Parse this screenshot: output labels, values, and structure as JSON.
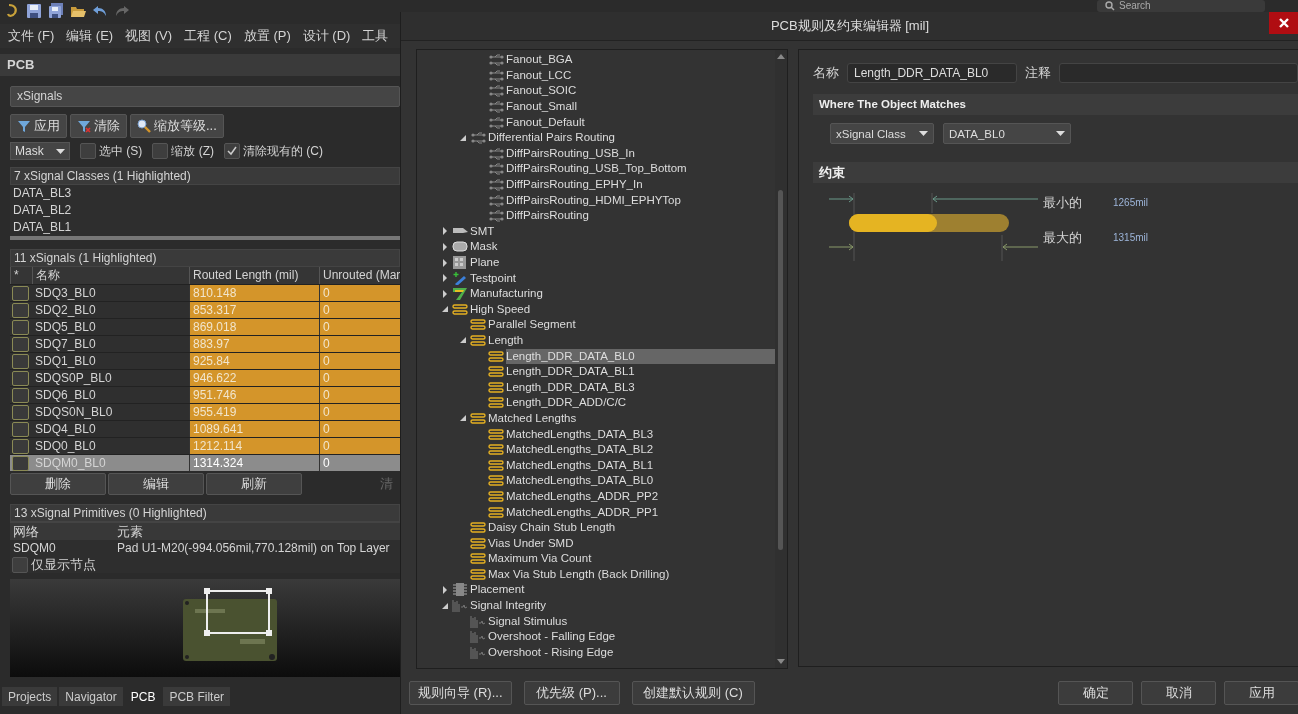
{
  "menu": [
    "文件 (F)",
    "编辑 (E)",
    "视图 (V)",
    "工程 (C)",
    "放置 (P)",
    "设计 (D)",
    "工具"
  ],
  "search": {
    "placeholder": "Search"
  },
  "panel": {
    "title": "PCB",
    "mode": "xSignals",
    "buttons": [
      {
        "kind": "filter",
        "label": "应用"
      },
      {
        "kind": "clear",
        "label": "清除"
      },
      {
        "kind": "zoom",
        "label": "缩放等级..."
      }
    ],
    "mask": "Mask",
    "options": [
      {
        "label": "选中 (S)",
        "checked": false
      },
      {
        "label": "缩放 (Z)",
        "checked": false
      },
      {
        "label": "清除现有的 (C)",
        "checked": true
      }
    ],
    "classes": {
      "header": "7 xSignal Classes (1 Highlighted)",
      "rows": [
        "DATA_BL3",
        "DATA_BL2",
        "DATA_BL1"
      ]
    },
    "signals": {
      "header": "11 xSignals (1 Highlighted)",
      "columns": [
        "*",
        "名称",
        "Routed Length (mil)",
        "Unrouted (Mar"
      ],
      "rows": [
        {
          "name": "SDQ3_BL0",
          "routed": "810.148",
          "unrouted": "0",
          "selected": false
        },
        {
          "name": "SDQ2_BL0",
          "routed": "853.317",
          "unrouted": "0",
          "selected": false
        },
        {
          "name": "SDQ5_BL0",
          "routed": "869.018",
          "unrouted": "0",
          "selected": false
        },
        {
          "name": "SDQ7_BL0",
          "routed": "883.97",
          "unrouted": "0",
          "selected": false
        },
        {
          "name": "SDQ1_BL0",
          "routed": "925.84",
          "unrouted": "0",
          "selected": false
        },
        {
          "name": "SDQS0P_BL0",
          "routed": "946.622",
          "unrouted": "0",
          "selected": false
        },
        {
          "name": "SDQ6_BL0",
          "routed": "951.746",
          "unrouted": "0",
          "selected": false
        },
        {
          "name": "SDQS0N_BL0",
          "routed": "955.419",
          "unrouted": "0",
          "selected": false
        },
        {
          "name": "SDQ4_BL0",
          "routed": "1089.641",
          "unrouted": "0",
          "selected": false
        },
        {
          "name": "SDQ0_BL0",
          "routed": "1212.114",
          "unrouted": "0",
          "selected": false
        },
        {
          "name": "SDQM0_BL0",
          "routed": "1314.324",
          "unrouted": "0",
          "selected": true
        }
      ],
      "buttons": [
        {
          "label": "删除",
          "disabled": false
        },
        {
          "label": "编辑",
          "disabled": false
        },
        {
          "label": "刷新",
          "disabled": false
        },
        {
          "label": "清",
          "disabled": true
        }
      ]
    },
    "primitives": {
      "header": "13 xSignal Primitives (0 Highlighted)",
      "columns": [
        "网络",
        "元素"
      ],
      "rows": [
        {
          "net": "SDQM0",
          "element": "Pad U1-M20(-994.056mil,770.128mil) on Top Layer"
        }
      ],
      "nodes_only": {
        "label": "仅显示节点",
        "checked": false
      }
    },
    "tabs": [
      {
        "label": "Projects",
        "selected": false
      },
      {
        "label": "Navigator",
        "selected": false
      },
      {
        "label": "PCB",
        "selected": true
      },
      {
        "label": "PCB Filter",
        "selected": false
      }
    ]
  },
  "dialog": {
    "title": "PCB规则及约束编辑器 [mil]",
    "tree": [
      {
        "children": [
          {
            "children": [
              {
                "kind": "routing",
                "label": "Fanout_BGA",
                "selected": false
              },
              {
                "kind": "routing",
                "label": "Fanout_LCC",
                "selected": false
              },
              {
                "kind": "routing",
                "label": "Fanout_SOIC",
                "selected": false
              },
              {
                "kind": "routing",
                "label": "Fanout_Small",
                "selected": false
              },
              {
                "kind": "routing",
                "label": "Fanout_Default",
                "selected": false
              }
            ]
          },
          {
            "kind": "routing",
            "label": "Differential Pairs Routing",
            "expanded": true,
            "selected": false,
            "children": [
              {
                "kind": "routing",
                "label": "DiffPairsRouting_USB_In",
                "selected": false
              },
              {
                "kind": "routing",
                "label": "DiffPairsRouting_USB_Top_Bottom",
                "selected": false
              },
              {
                "kind": "routing",
                "label": "DiffPairsRouting_EPHY_In",
                "selected": false
              },
              {
                "kind": "routing",
                "label": "DiffPairsRouting_HDMI_EPHYTop",
                "selected": false
              },
              {
                "kind": "routing",
                "label": "DiffPairsRouting",
                "selected": false
              }
            ]
          }
        ]
      },
      {
        "kind": "smt",
        "label": "SMT",
        "expanded": false,
        "selected": false
      },
      {
        "kind": "mask",
        "label": "Mask",
        "expanded": false,
        "selected": false
      },
      {
        "kind": "plane",
        "label": "Plane",
        "expanded": false,
        "selected": false
      },
      {
        "kind": "testpoint",
        "label": "Testpoint",
        "expanded": false,
        "selected": false
      },
      {
        "kind": "manufacturing",
        "label": "Manufacturing",
        "expanded": false,
        "selected": false
      },
      {
        "kind": "highspeed",
        "label": "High Speed",
        "expanded": true,
        "selected": false,
        "children": [
          {
            "kind": "highspeed",
            "label": "Parallel Segment",
            "selected": false
          },
          {
            "kind": "highspeed",
            "label": "Length",
            "expanded": true,
            "selected": false,
            "children": [
              {
                "kind": "highspeed",
                "label": "Length_DDR_DATA_BL0",
                "selected": true
              },
              {
                "kind": "highspeed",
                "label": "Length_DDR_DATA_BL1",
                "selected": false
              },
              {
                "kind": "highspeed",
                "label": "Length_DDR_DATA_BL3",
                "selected": false
              },
              {
                "kind": "highspeed",
                "label": "Length_DDR_ADD/C/C",
                "selected": false
              }
            ]
          },
          {
            "kind": "highspeed",
            "label": "Matched Lengths",
            "expanded": true,
            "selected": false,
            "children": [
              {
                "kind": "highspeed",
                "label": "MatchedLengths_DATA_BL3",
                "selected": false
              },
              {
                "kind": "highspeed",
                "label": "MatchedLengths_DATA_BL2",
                "selected": false
              },
              {
                "kind": "highspeed",
                "label": "MatchedLengths_DATA_BL1",
                "selected": false
              },
              {
                "kind": "highspeed",
                "label": "MatchedLengths_DATA_BL0",
                "selected": false
              },
              {
                "kind": "highspeed",
                "label": "MatchedLengths_ADDR_PP2",
                "selected": false
              },
              {
                "kind": "highspeed",
                "label": "MatchedLengths_ADDR_PP1",
                "selected": false
              }
            ]
          },
          {
            "kind": "highspeed",
            "label": "Daisy Chain Stub Length",
            "selected": false
          },
          {
            "kind": "highspeed",
            "label": "Vias Under SMD",
            "selected": false
          },
          {
            "kind": "highspeed",
            "label": "Maximum Via Count",
            "selected": false
          },
          {
            "kind": "highspeed",
            "label": "Max Via Stub Length (Back Drilling)",
            "selected": false
          }
        ]
      },
      {
        "kind": "placement",
        "label": "Placement",
        "expanded": false,
        "selected": false
      },
      {
        "kind": "si",
        "label": "Signal Integrity",
        "expanded": true,
        "selected": false,
        "children": [
          {
            "kind": "si",
            "label": "Signal Stimulus",
            "selected": false
          },
          {
            "kind": "si",
            "label": "Overshoot - Falling Edge",
            "selected": false
          },
          {
            "kind": "si",
            "label": "Overshoot - Rising Edge",
            "selected": false
          }
        ]
      }
    ],
    "name_label": "名称",
    "name_value": "Length_DDR_DATA_BL0",
    "comment_label": "注释",
    "match_title": "Where The Object Matches",
    "match_type": "xSignal Class",
    "match_value": "DATA_BL0",
    "constraints_title": "约束",
    "min_label": "最小的",
    "min_value": "1265mil",
    "max_label": "最大的",
    "max_value": "1315mil",
    "buttons_left": [
      "规则向导 (R)...",
      "优先级 (P)...",
      "创建默认规则 (C)"
    ],
    "buttons_right": [
      "确定",
      "取消",
      "应用"
    ]
  }
}
